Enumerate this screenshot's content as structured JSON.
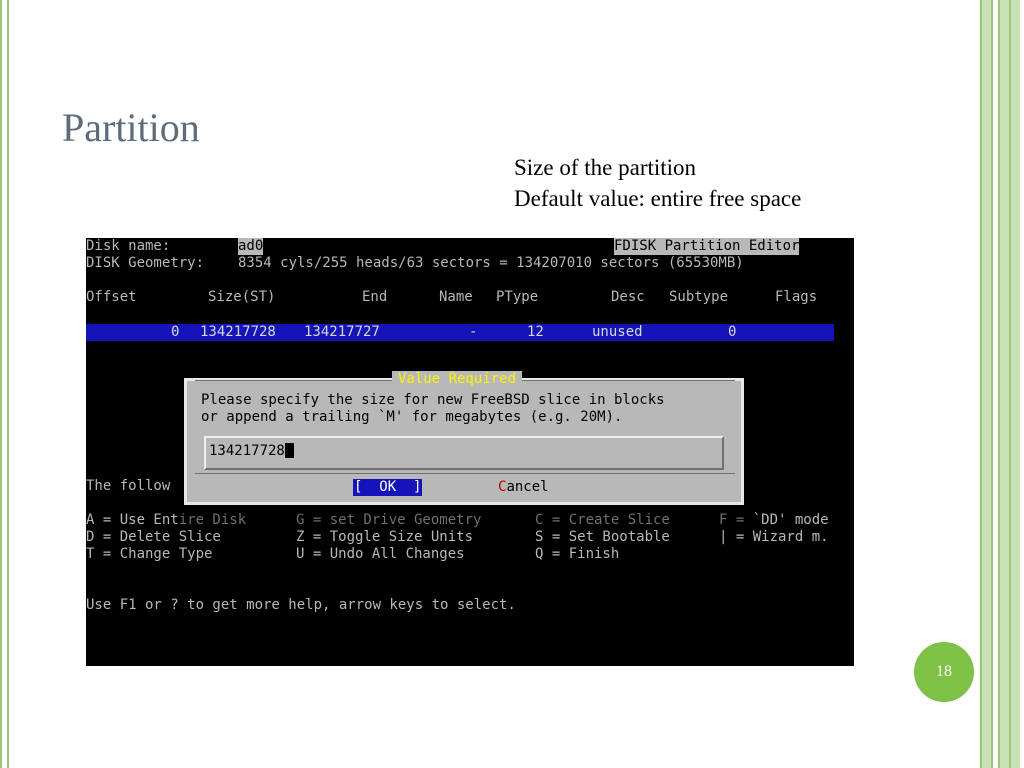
{
  "slide": {
    "title": "Partition",
    "note_line1": "Size of the partition",
    "note_line2": "Default value: entire free space",
    "page_number": "18"
  },
  "terminal": {
    "disk_label": "Disk name:",
    "disk_name": "ad0",
    "editor_title": "FDISK Partition Editor",
    "geometry_label": "DISK Geometry:",
    "geometry_value": "8354 cyls/255 heads/63 sectors = 134207010 sectors (65530MB)",
    "columns": {
      "offset": "Offset",
      "size": "Size(ST)",
      "end": "End",
      "name": "Name",
      "ptype": "PType",
      "desc": "Desc",
      "subtype": "Subtype",
      "flags": "Flags"
    },
    "row": {
      "offset": "0",
      "size": "134217728",
      "end": "134217727",
      "name": "-",
      "ptype": "12",
      "desc": "unused",
      "subtype": "0"
    },
    "following_text": "The follow",
    "commands": [
      [
        "A = Use Ent",
        "ire Disk",
        "G = set Drive Geometry",
        "C = Create Slice",
        "F = ",
        "`DD' mode"
      ],
      [
        "D = Delete Slice",
        "Z = Toggle Size Units",
        "S = Set Bootable",
        "| = Wizard m."
      ],
      [
        "T = Change Type",
        "U = Undo All Changes",
        "Q = Finish"
      ]
    ],
    "help": "Use F1 or ? to get more help, arrow keys to select."
  },
  "dialog": {
    "title": "Value Required",
    "message_line1": "Please specify the size for new FreeBSD slice in blocks",
    "message_line2": "or append a trailing `M' for megabytes (e.g. 20M).",
    "input_value": "134217728",
    "ok_label": "[  OK  ]",
    "cancel_hotkey": "C",
    "cancel_rest": "ancel"
  },
  "colors": {
    "frame_green": "#9bc47d",
    "page_badge": "#7dc244",
    "title_gray": "#5e6b7a",
    "selection_blue": "#1414b8",
    "dialog_gray": "#b8b8b8",
    "dialog_title_yellow": "#fff100"
  }
}
